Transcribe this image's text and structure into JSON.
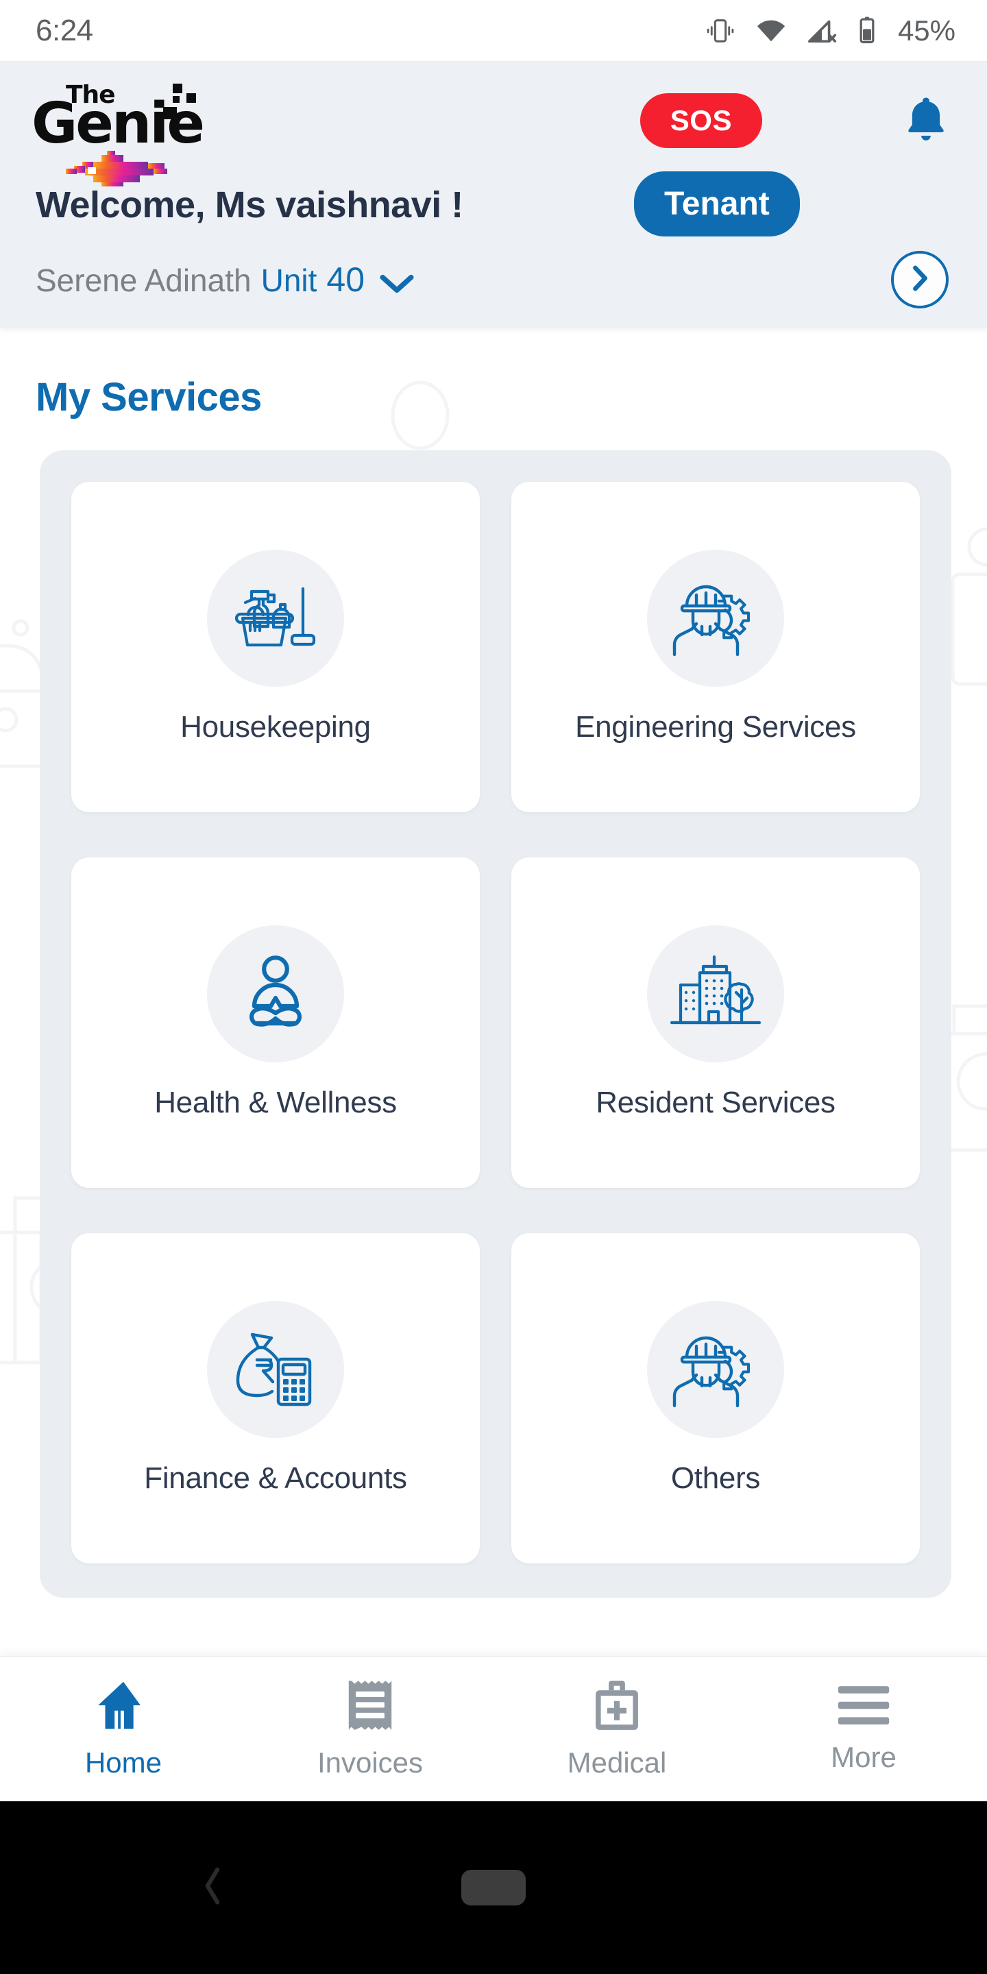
{
  "status_bar": {
    "time": "6:24",
    "battery_percent": "45%",
    "icons": [
      "vibrate-icon",
      "wifi-icon",
      "cellular-off-icon",
      "battery-icon"
    ]
  },
  "header": {
    "logo": {
      "top_word": "The",
      "main_word": "Genie",
      "mark": "genie-lamp-logo"
    },
    "sos_label": "SOS",
    "notification_icon": "bell-icon",
    "welcome_text": "Welcome,  Ms vaishnavi !",
    "role_badge": "Tenant",
    "property_name": "Serene Adinath",
    "unit_label": "Unit",
    "unit_number": "40",
    "unit_chevron_icon": "chevron-down-icon",
    "forward_icon": "chevron-right-icon"
  },
  "main": {
    "section_title": "My Services",
    "services": [
      {
        "label": "Housekeeping",
        "icon": "cleaning-supplies-icon"
      },
      {
        "label": "Engineering Services",
        "icon": "engineer-gear-icon"
      },
      {
        "label": "Health & Wellness",
        "icon": "yoga-lotus-icon"
      },
      {
        "label": "Resident Services",
        "icon": "buildings-tree-icon"
      },
      {
        "label": "Finance & Accounts",
        "icon": "money-bag-calculator-icon"
      },
      {
        "label": "Others",
        "icon": "engineer-gear-icon"
      }
    ]
  },
  "bottom_nav": {
    "items": [
      {
        "label": "Home",
        "icon": "home-icon",
        "active": true
      },
      {
        "label": "Invoices",
        "icon": "receipt-icon",
        "active": false
      },
      {
        "label": "Medical",
        "icon": "medical-bag-icon",
        "active": false
      },
      {
        "label": "More",
        "icon": "hamburger-menu-icon",
        "active": false
      }
    ]
  },
  "android_nav": {
    "back_icon": "back-chevron-icon",
    "home_pill": "home-pill-handle"
  },
  "colors": {
    "brand_blue": "#0f6cb0",
    "sos_red": "#f5202f",
    "header_bg": "#edf1f5",
    "panel_bg": "#eaeef2",
    "text_dark": "#303b4f",
    "text_muted": "#7b8186"
  }
}
